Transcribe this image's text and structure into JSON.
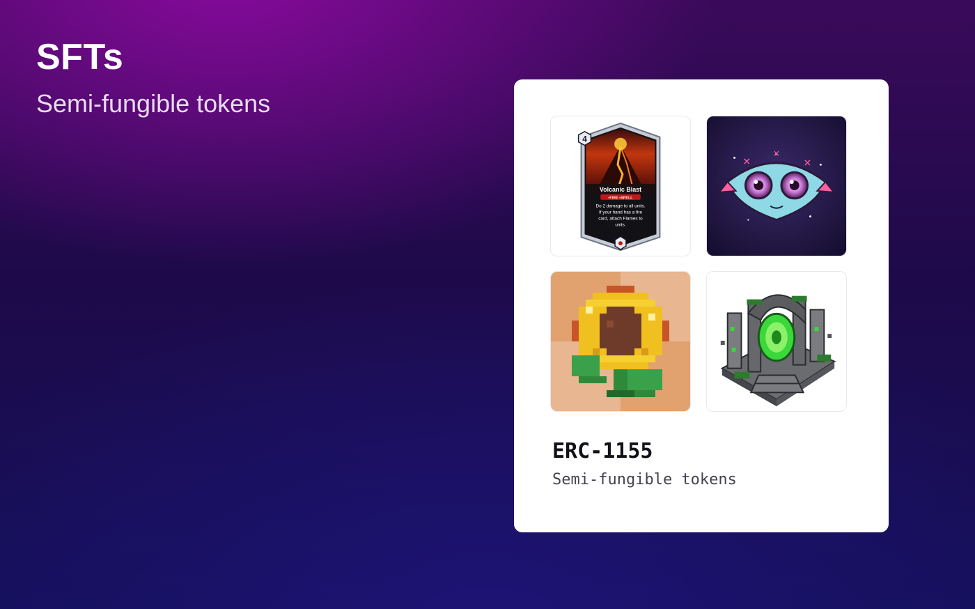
{
  "header": {
    "title": "SFTs",
    "subtitle": "Semi-fungible tokens"
  },
  "card": {
    "standard": "ERC-1155",
    "description": "Semi-fungible tokens",
    "tiles": [
      {
        "icon": "volcanic-blast-card-icon",
        "card_cost": "4",
        "card_name": "Volcanic Blast",
        "card_type": "•FIRE •SPELL",
        "card_text_1": "Do 2 damage to all units.",
        "card_text_2": "If your hand has a fire",
        "card_text_3": "card, attach Flames to",
        "card_text_4": "units."
      },
      {
        "icon": "creature-mask-icon"
      },
      {
        "icon": "pixel-sunflower-icon"
      },
      {
        "icon": "stone-portal-icon"
      }
    ]
  },
  "colors": {
    "accent_purple": "#7a0f9a",
    "card_background": "#ffffff"
  }
}
